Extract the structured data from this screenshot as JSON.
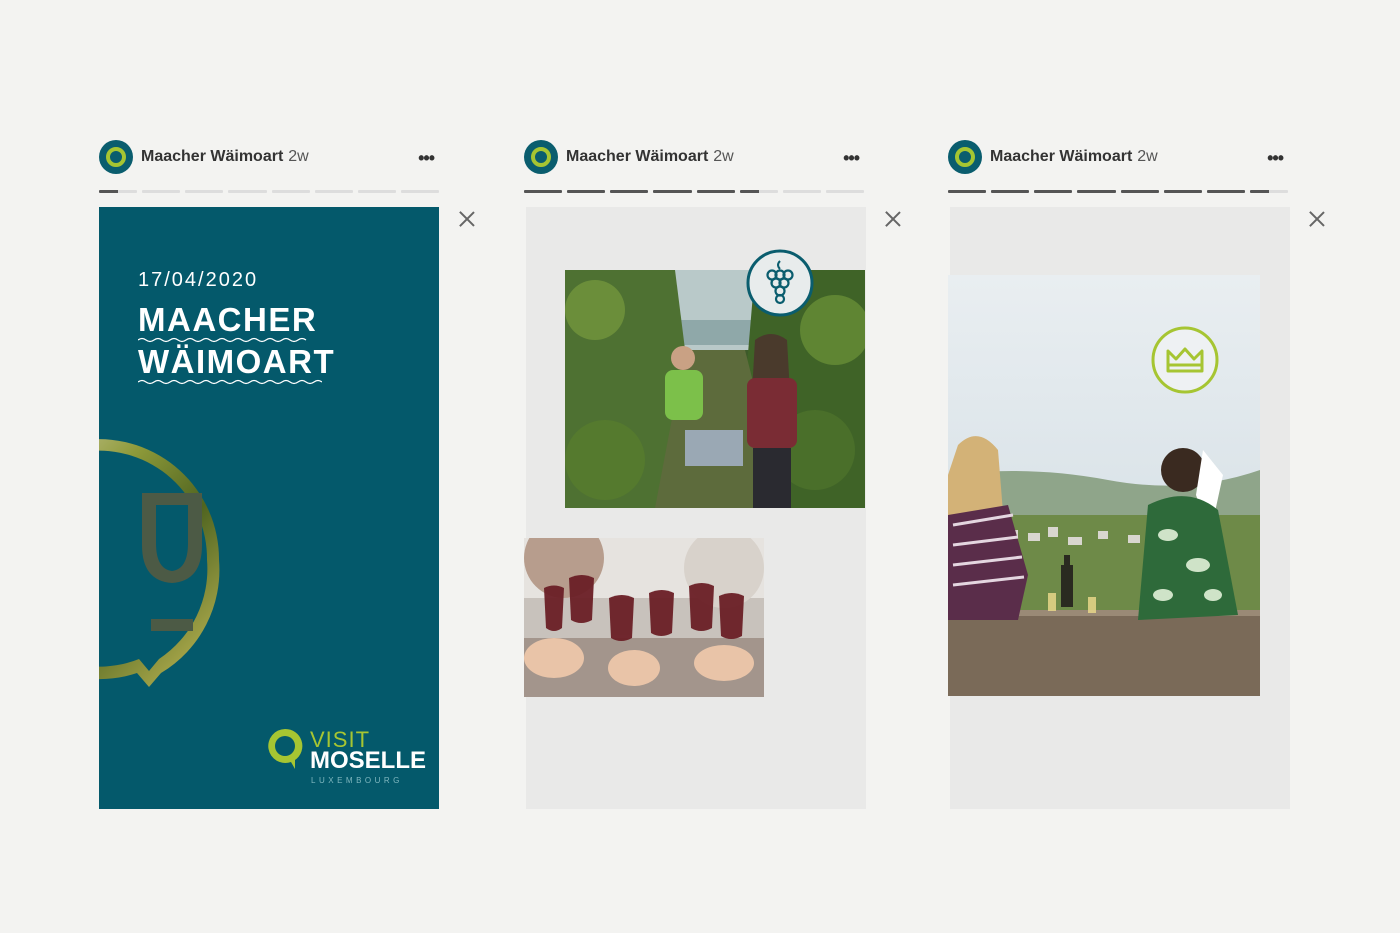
{
  "stories": [
    {
      "account": "Maacher Wäimoart",
      "age": "2w",
      "more": "•••",
      "progress": [
        "partial",
        "todo",
        "todo",
        "todo",
        "todo",
        "todo",
        "todo",
        "todo"
      ]
    },
    {
      "account": "Maacher Wäimoart",
      "age": "2w",
      "more": "•••",
      "progress": [
        "done",
        "done",
        "done",
        "done",
        "done",
        "partial",
        "todo",
        "todo"
      ]
    },
    {
      "account": "Maacher Wäimoart",
      "age": "2w",
      "more": "•••",
      "progress": [
        "done",
        "done",
        "done",
        "done",
        "done",
        "done",
        "done",
        "partial"
      ]
    }
  ],
  "poster": {
    "date": "17/04/2020",
    "title_line1": "MAACHER",
    "title_line2": "WÄIMOART",
    "logo_visit": "VISIT",
    "logo_moselle": "MOSELLE",
    "logo_lux": "LUXEMBOURG"
  },
  "colors": {
    "teal": "#04596b",
    "green": "#a6c532",
    "background": "#f3f3f1"
  }
}
